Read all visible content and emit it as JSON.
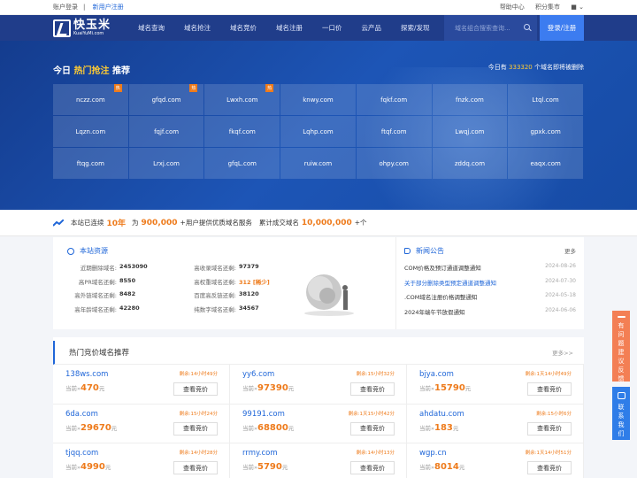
{
  "topbar": {
    "login": "账户登录",
    "register": "新用户注册",
    "help": "帮助中心",
    "points": "积分集市"
  },
  "logo": {
    "cn": "快玉米",
    "en": "KuaiYuMi.com"
  },
  "nav": [
    "域名查询",
    "域名抢注",
    "域名竞价",
    "域名注册",
    "一口价",
    "云产品",
    "探索/发现"
  ],
  "search": {
    "placeholder": "域名组合搜索查询..."
  },
  "login_button": "登录/注册",
  "hero": {
    "title_pre": "今日",
    "title_hot": "热门抢注",
    "title_post": "推荐",
    "count_pre": "今日有",
    "count_num": "333320",
    "count_post": "个域名即将被删除",
    "hot_label": "热",
    "domains": [
      {
        "name": "nczz.com",
        "hot": true
      },
      {
        "name": "gfqd.com",
        "hot": true
      },
      {
        "name": "Lwxh.com",
        "hot": true
      },
      {
        "name": "knwy.com",
        "hot": false
      },
      {
        "name": "fqkf.com",
        "hot": false
      },
      {
        "name": "fnzk.com",
        "hot": false
      },
      {
        "name": "Ltql.com",
        "hot": false
      },
      {
        "name": "Lqzn.com",
        "hot": false
      },
      {
        "name": "fqjf.com",
        "hot": false
      },
      {
        "name": "fkqf.com",
        "hot": false
      },
      {
        "name": "Lqhp.com",
        "hot": false
      },
      {
        "name": "ftqf.com",
        "hot": false
      },
      {
        "name": "Lwqj.com",
        "hot": false
      },
      {
        "name": "gpxk.com",
        "hot": false
      },
      {
        "name": "ftqg.com",
        "hot": false
      },
      {
        "name": "Lrxj.com",
        "hot": false
      },
      {
        "name": "gfqL.com",
        "hot": false
      },
      {
        "name": "ruiw.com",
        "hot": false
      },
      {
        "name": "ohpy.com",
        "hot": false
      },
      {
        "name": "zddq.com",
        "hot": false
      },
      {
        "name": "eaqx.com",
        "hot": false
      }
    ]
  },
  "stats": {
    "t1": "本站已连续",
    "years": "10年",
    "t2": "为",
    "users": "900,000",
    "t3": "+用户提供优质域名服务",
    "t4": "累计成交域名",
    "deals": "10,000,000",
    "t5": "+个"
  },
  "resources": {
    "title": "本站资源",
    "left": [
      {
        "label": "近期删除域名:",
        "value": "2453090"
      },
      {
        "label": "高PR域名还剩:",
        "value": "8550"
      },
      {
        "label": "高外链域名还剩:",
        "value": "8482"
      },
      {
        "label": "高年龄域名还剩:",
        "value": "42280"
      }
    ],
    "right": [
      {
        "label": "高收录域名还剩:",
        "value": "97379"
      },
      {
        "label": "高权重域名还剩:",
        "value": "312 [稀少]"
      },
      {
        "label": "百度高反链还剩:",
        "value": "38120"
      },
      {
        "label": "纯数字域名还剩:",
        "value": "34567"
      }
    ]
  },
  "news": {
    "title": "新闻公告",
    "more": "更多",
    "items": [
      {
        "text": "COM价格及预订通道调整通知",
        "date": "2024-08-26"
      },
      {
        "text": "关于部分删除类型预定通道调整通知",
        "date": "2024-07-30"
      },
      {
        "text": ".COM域名注册价格调整通知",
        "date": "2024-05-18"
      },
      {
        "text": "2024年端午节放假通知",
        "date": "2024-06-06"
      }
    ]
  },
  "auction": {
    "title": "热门竞价域名推荐",
    "more": "更多>>",
    "price_label": "当前»",
    "unit": "元",
    "button": "查看竞价",
    "items": [
      {
        "domain": "138ws.com",
        "time": "剩余:14小时49分",
        "price": "470"
      },
      {
        "domain": "yy6.com",
        "time": "剩余:15小时32分",
        "price": "97390"
      },
      {
        "domain": "bjya.com",
        "time": "剩余:1天14小时49分",
        "price": "15790"
      },
      {
        "domain": "6da.com",
        "time": "剩余:15小时24分",
        "price": "29670"
      },
      {
        "domain": "99191.com",
        "time": "剩余:1天15小时42分",
        "price": "68800"
      },
      {
        "domain": "ahdatu.com",
        "time": "剩余:15小时6分",
        "price": "183"
      },
      {
        "domain": "tjqq.com",
        "time": "剩余:14小时28分",
        "price": "4990"
      },
      {
        "domain": "rrmy.com",
        "time": "剩余:14小时13分",
        "price": "5790"
      },
      {
        "domain": "wgp.cn",
        "time": "剩余:1天14小时51分",
        "price": "8014"
      }
    ]
  },
  "float": {
    "feedback": "有问题建议反馈",
    "contact": "联系我们"
  },
  "colors": {
    "nav": "#203d8a",
    "accent": "#1f66d8",
    "orange": "#ee7b1c"
  }
}
